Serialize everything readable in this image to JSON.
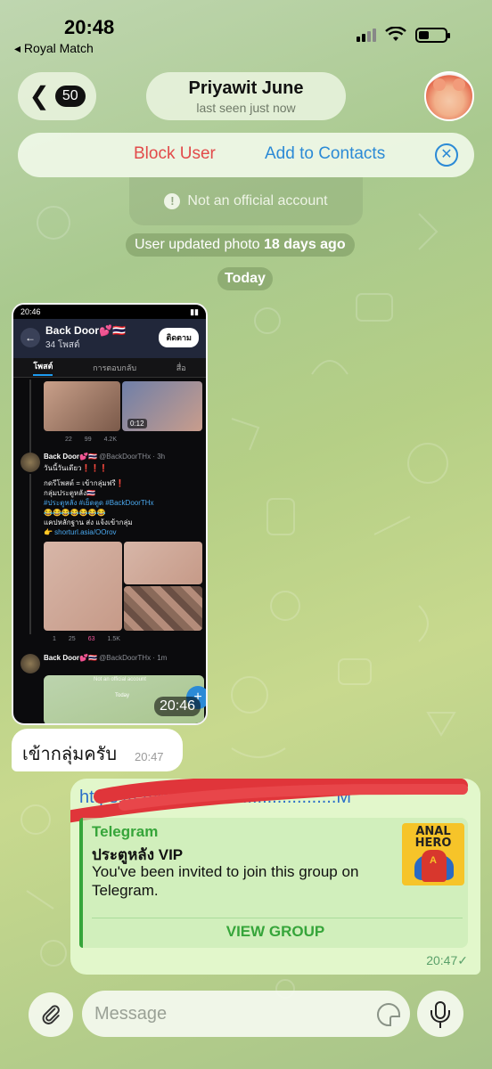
{
  "status_bar": {
    "time": "20:48",
    "back_app": "◂ Royal Match"
  },
  "header": {
    "back_count": "50",
    "contact_name": "Priyawit June",
    "contact_status": "last seen just now"
  },
  "action_bar": {
    "block_label": "Block User",
    "add_label": "Add to Contacts"
  },
  "info": {
    "not_official": "Not an official account"
  },
  "service_msg": {
    "prefix": "User updated photo ",
    "emphasis": "18 days ago"
  },
  "date_separator": "Today",
  "screenshot": {
    "status_time": "20:46",
    "channel_name": "Back Door💕🇹🇭",
    "channel_sub": "34 โพสต์",
    "follow_label": "ติดตาม",
    "tabs": [
      "โพสต์",
      "การตอบกลับ",
      "สื่อ"
    ],
    "video_duration": "0:12",
    "post1_stats": [
      "",
      "22",
      "99",
      "4.2K"
    ],
    "post2_author": "Back Door💕🇹🇭",
    "post2_handle": "@BackDoorTHx · 3h",
    "post2_lines": [
      "วันนี้วันเดียว❗❗❗",
      "",
      "กดรีโพสต์ = เข้ากลุ่มฟรี❗",
      "กลุ่มประตูหลัง🇹🇭",
      "#ประตูหลัง #เย็ดตูด #BackDoorTHx",
      "😂😂😂😂😂😂😂",
      "แคปหลักฐาน ส่ง แจ้งเข้ากลุ่ม",
      "👉 shorturl.asia/OOrov"
    ],
    "post2_stats": [
      "1",
      "25",
      "63",
      "1.5K"
    ],
    "post3_author": "Back Door💕🇹🇭",
    "post3_handle": "@BackDoorTHx · 1m",
    "mini_notice": "Not an official account",
    "mini_today": "Today",
    "time_overlay": "20:46"
  },
  "incoming": {
    "text": "เข้ากลุ่มครับ",
    "time": "20:47"
  },
  "outgoing": {
    "link_text": "https://t.me/+...............................M",
    "preview_site": "Telegram",
    "preview_title": "ประตูหลัง VIP",
    "preview_desc": "You've been invited to join this group on Telegram.",
    "thumb_text": "ANAL HERO",
    "button_label": "VIEW GROUP",
    "time": "20:47",
    "check": "✓"
  },
  "input": {
    "placeholder": "Message"
  },
  "colors": {
    "block_red": "#e24a4a",
    "link_blue": "#2b8ad6",
    "telegram_green": "#36a53a",
    "outgoing_bubble": "#e2f7cb"
  },
  "icons": [
    "chevron-left-icon",
    "close-circle-icon",
    "info-icon",
    "paperclip-icon",
    "sticker-icon",
    "microphone-icon",
    "checkmark-icon"
  ]
}
